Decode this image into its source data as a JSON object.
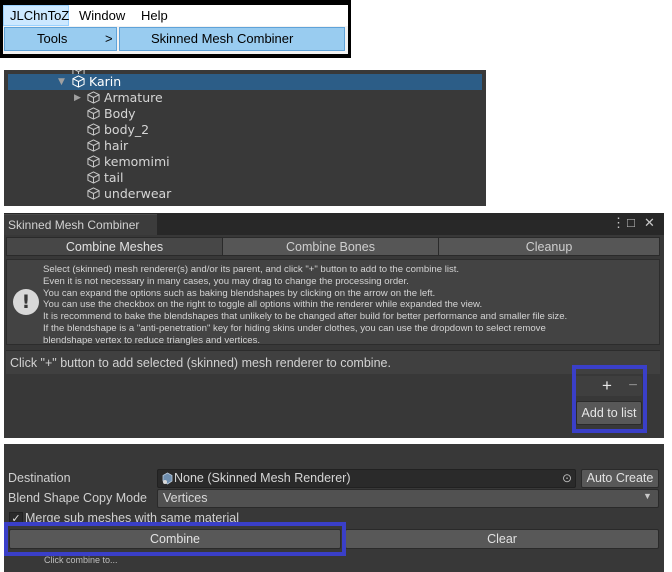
{
  "menubar": {
    "items": [
      "JLChnToZ",
      "Window",
      "Help"
    ],
    "submenu": {
      "tools_label": "Tools",
      "tools_arrow": ">",
      "item": "Skinned Mesh Combiner"
    }
  },
  "hierarchy": {
    "root": "Karin",
    "children": [
      "Armature",
      "Body",
      "body_2",
      "hair",
      "kemomimi",
      "tail",
      "underwear"
    ]
  },
  "window": {
    "tab_title": "Skinned Mesh Combiner",
    "controls": {
      "menu": "⋮",
      "maximize": "□",
      "close": "✕"
    },
    "tabs": [
      "Combine Meshes",
      "Combine Bones",
      "Cleanup"
    ],
    "help_icon": "!",
    "help_lines": [
      "Select (skinned) mesh renderer(s) and/or its parent, and click \"+\" button to add to the combine list.",
      "Even it is not necessary in many cases, you may drag to change the processing order.",
      "You can expand the options such as baking blendshapes by clicking on the arrow on the left.",
      "You can use the checkbox on the right to toggle all options within the renderer while expanded the view.",
      "It is recommend to bake the blendshapes that unlikely to be changed after build for better performance and smaller file size.",
      "If the blendshape is a \"anti-penetration\" key for hiding skins under clothes, you can use the dropdown to select remove",
      "blendshape vertex to reduce triangles and vertices."
    ],
    "hint": "Click \"+\" button to add selected (skinned) mesh renderer to combine.",
    "plus": "+",
    "minus": "−",
    "add_to_list": "Add to list"
  },
  "destination": {
    "label": "Destination",
    "value": "None (Skinned Mesh Renderer)",
    "picker": "⊙",
    "auto_create": "Auto Create",
    "blend_label": "Blend Shape Copy Mode",
    "blend_value": "Vertices",
    "merge_check": "✓",
    "merge_label": "Merge sub meshes with same material",
    "combine": "Combine",
    "clear": "Clear",
    "bottom_hint": "Click combine to..."
  },
  "colors": {
    "highlight": "#3a3fc8",
    "selection": "#2c5d87",
    "menu_hover": "#99ccf0"
  }
}
